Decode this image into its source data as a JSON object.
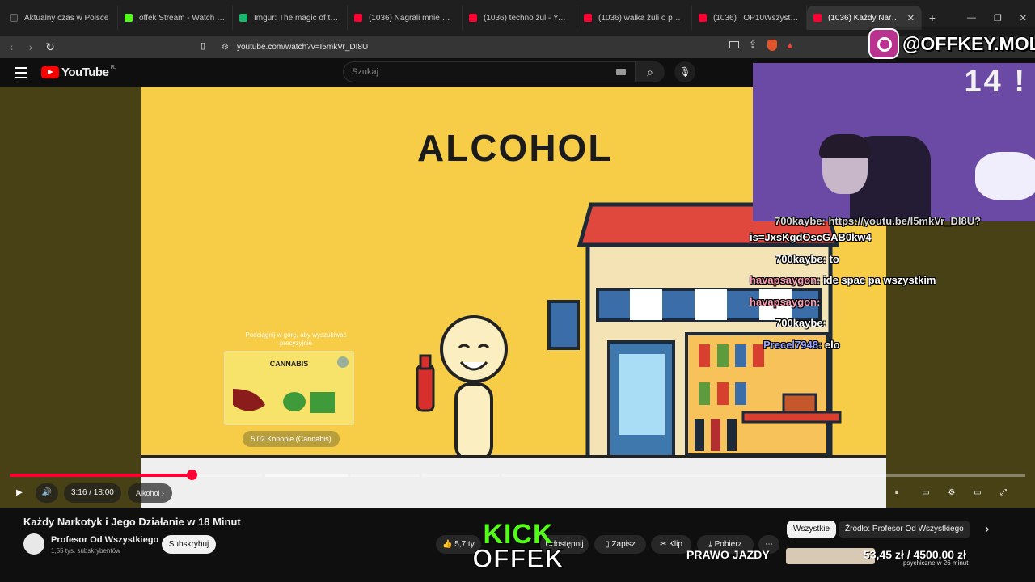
{
  "browser": {
    "tabs": [
      {
        "title": "Aktualny czas w Polsce",
        "color": "#2b2b2b"
      },
      {
        "title": "offek Stream - Watch Live on K",
        "color": "#53fc18"
      },
      {
        "title": "Imgur: The magic of the Interne",
        "color": "#1bb76e"
      },
      {
        "title": "(1036) Nagrali mnie w sklepie",
        "color": "#ff0033"
      },
      {
        "title": "(1036) techno żul - YouTube",
        "color": "#ff0033"
      },
      {
        "title": "(1036) walka żuli o puszki - Yo",
        "color": "#ff0033"
      },
      {
        "title": "(1036) TOP10Wszystkiego - Yo",
        "color": "#ff0033"
      },
      {
        "title": "(1036) Każdy Narkotyk i Je",
        "color": "#ff0033"
      }
    ],
    "url": "youtube.com/watch?v=I5mkVr_DI8U"
  },
  "youtube": {
    "logo": "YouTube",
    "region": "PL",
    "search_placeholder": "Szukaj"
  },
  "video": {
    "scene_title": "ALCOHOL",
    "preview_hint": "Podciągnij w górę, aby wyszukiwać precyzyjnie",
    "preview_label": "CANNABIS",
    "chapter_preview": "5:02  Konopie (Cannabis)",
    "time": "3:16 / 18:00",
    "chapter": "Alkohol",
    "progress_fraction": 0.18
  },
  "stream_overlay": {
    "instagram": "@OFFKEY.MOLLY",
    "timer": "14 !",
    "chat": [
      {
        "text": "700kaybe: https://youtu.be/I5mkVr_DI8U?"
      },
      {
        "text": "is=JxsKgdOscGAB0kw4"
      },
      {
        "text": "700kaybe: to"
      },
      {
        "user": "havapsaygon:",
        "msg": " ide spac pa wszystkim"
      },
      {
        "user": "havapsaygon:",
        "msg": ""
      },
      {
        "user": "700kaybe:",
        "msg": ""
      },
      {
        "user": "Precel7948:",
        "msg": " elo"
      }
    ],
    "kick_top": "KICK",
    "kick_bottom": "OFFEK",
    "goal_title": "PRAWO JAZDY",
    "goal_amount": "53,45 zł / 4500,00 zł",
    "goal_sub": "psychiczne w 26 minut"
  },
  "below": {
    "title": "Każdy Narkotyk i Jego Działanie w 18 Minut",
    "channel": "Profesor Od Wszystkiego",
    "subscribers": "1,55 tys. subskrybentów",
    "subscribe": "Subskrybuj",
    "likes": "5,7 ty",
    "share": "Udostępnij",
    "save": "Zapisz",
    "clip": "Klip",
    "download": "Pobierz",
    "filters": [
      "Wszystkie",
      "Źródło: Profesor Od Wszystkiego"
    ]
  }
}
